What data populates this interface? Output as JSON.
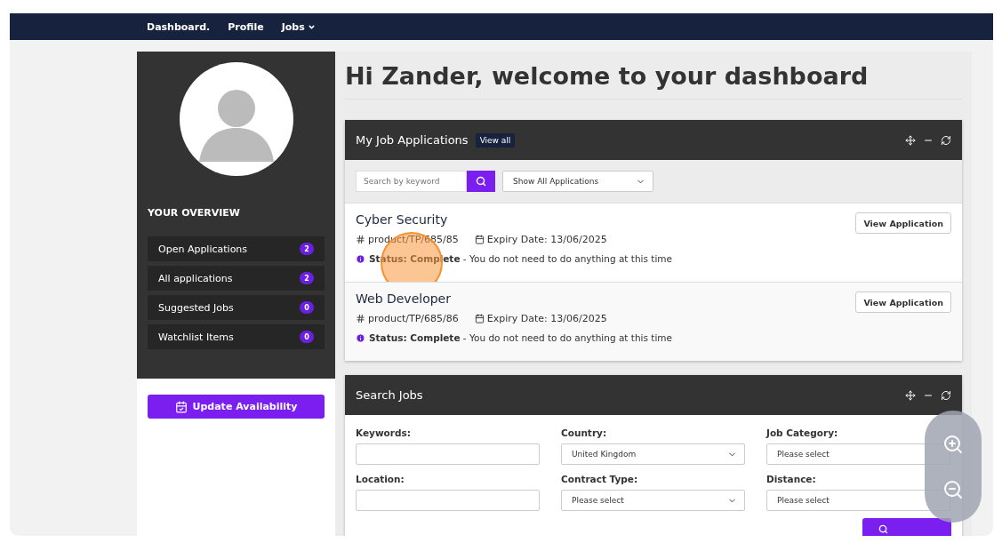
{
  "nav": [
    {
      "label": "Dashboard.",
      "dropdown": false
    },
    {
      "label": "Profile",
      "dropdown": false
    },
    {
      "label": "Jobs",
      "dropdown": true
    }
  ],
  "sidebar": {
    "heading": "YOUR OVERVIEW",
    "items": [
      {
        "label": "Open Applications",
        "count": "2"
      },
      {
        "label": "All applications",
        "count": "2"
      },
      {
        "label": "Suggested Jobs",
        "count": "0"
      },
      {
        "label": "Watchlist Items",
        "count": "0"
      }
    ],
    "button": "Update Availability"
  },
  "greeting": "Hi Zander, welcome to your dashboard",
  "applications_panel": {
    "title": "My Job Applications",
    "view_all": "View all",
    "search": {
      "placeholder": "Search by keyword"
    },
    "filter": "Show All Applications",
    "rows": [
      {
        "title": "Cyber Security",
        "reference": "product/TP/685/85",
        "expiry": "Expiry Date: 13/06/2025",
        "status": "**Status: Complete** - You do not need to do anything at this time",
        "button": "View Application",
        "highlighted": true
      },
      {
        "title": "Web Developer",
        "reference": "product/TP/685/86",
        "expiry": "Expiry Date: 13/06/2025",
        "status": "**Status: Complete** - You do not need to do anything at this time",
        "button": "View Application",
        "highlighted": false
      }
    ]
  },
  "search_panel": {
    "title": "Search Jobs",
    "fields": [
      {
        "label": "Keywords:",
        "kind": "text"
      },
      {
        "label": "Country:",
        "kind": "select",
        "value": "United Kingdom"
      },
      {
        "label": "Job Category:",
        "kind": "plain",
        "value": "Please select"
      },
      {
        "label": "Location:",
        "kind": "text"
      },
      {
        "label": "Contract Type:",
        "kind": "select",
        "value": "Please select"
      },
      {
        "label": "Distance:",
        "kind": "plain",
        "value": "Please select"
      }
    ]
  }
}
